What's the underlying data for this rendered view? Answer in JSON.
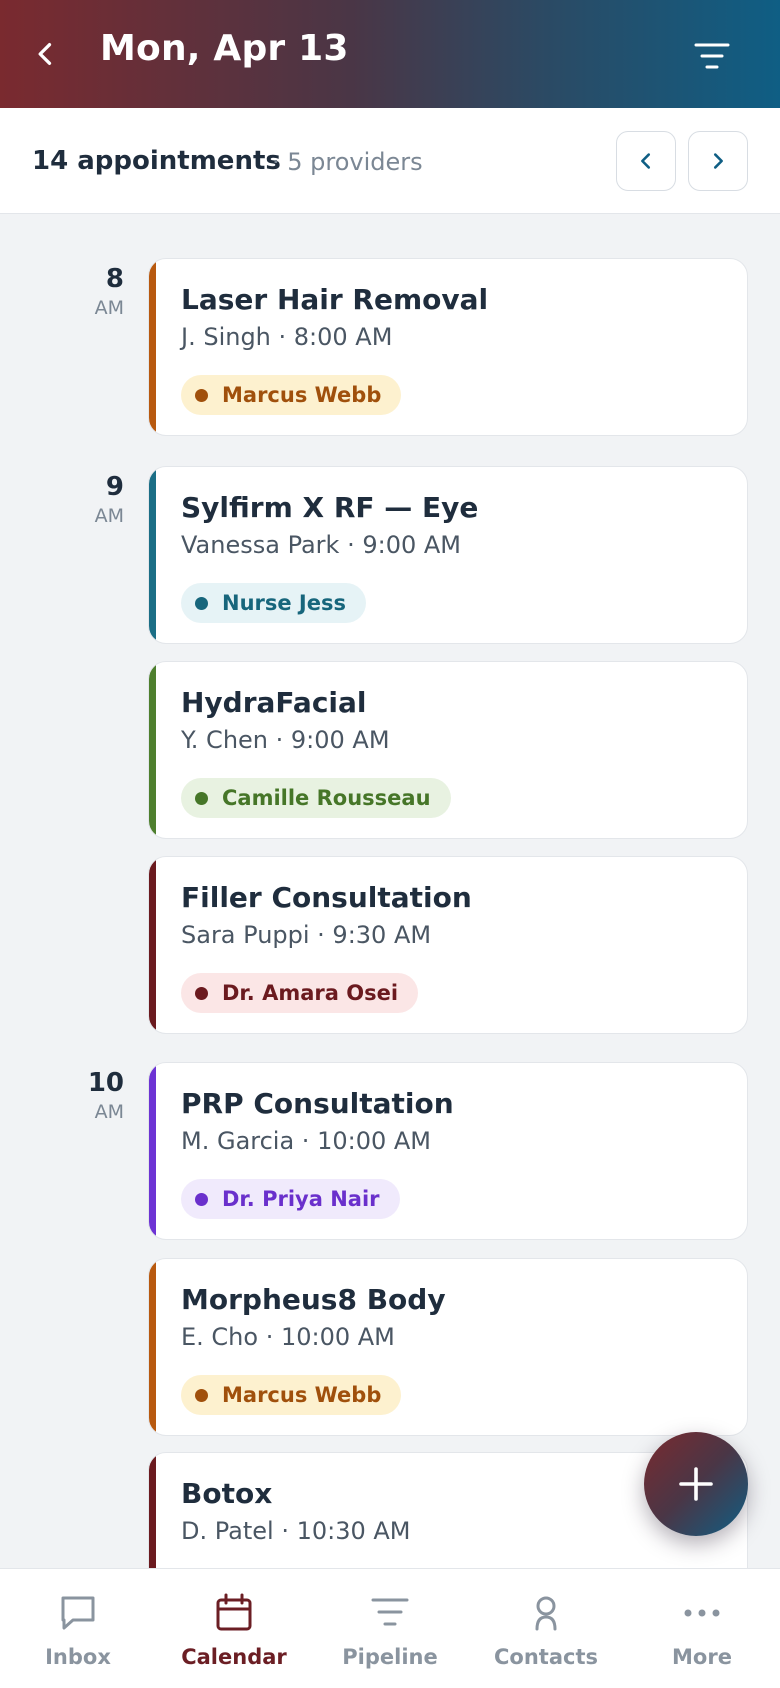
{
  "header": {
    "title": "Mon, Apr 13"
  },
  "summary": {
    "count": "14 appointments",
    "providers": "· 5 providers"
  },
  "hours": [
    {
      "hour": "8",
      "ampm": "AM"
    },
    {
      "hour": "9",
      "ampm": "AM"
    },
    {
      "hour": "10",
      "ampm": "AM"
    }
  ],
  "appointments": [
    {
      "title": "Laser Hair Removal",
      "subtitle": "J. Singh · 8:00 AM",
      "provider": "Marcus Webb",
      "accent": "#b8590f",
      "chip_bg": "#fdf1cf",
      "chip_fg": "#a0500c"
    },
    {
      "title": "Sylfirm X RF — Eye",
      "subtitle": "Vanessa Park · 9:00 AM",
      "provider": "Nurse Jess",
      "accent": "#1b6e86",
      "chip_bg": "#e6f3f6",
      "chip_fg": "#17667c"
    },
    {
      "title": "HydraFacial",
      "subtitle": "Y. Chen · 9:00 AM",
      "provider": "Camille Rousseau",
      "accent": "#4e7f2e",
      "chip_bg": "#e8f2e1",
      "chip_fg": "#467628"
    },
    {
      "title": "Filler Consultation",
      "subtitle": "Sara Puppi · 9:30 AM",
      "provider": "Dr. Amara Osei",
      "accent": "#6b1a1f",
      "chip_bg": "#fbe6e6",
      "chip_fg": "#6b1a1f"
    },
    {
      "title": "PRP Consultation",
      "subtitle": "M. Garcia · 10:00 AM",
      "provider": "Dr. Priya Nair",
      "accent": "#6d33d4",
      "chip_bg": "#f0eafc",
      "chip_fg": "#6a30cc"
    },
    {
      "title": "Morpheus8 Body",
      "subtitle": "E. Cho · 10:00 AM",
      "provider": "Marcus Webb",
      "accent": "#b8590f",
      "chip_bg": "#fdf1cf",
      "chip_fg": "#a0500c"
    },
    {
      "title": "Botox",
      "subtitle": "D. Patel · 10:30 AM",
      "provider": "",
      "accent": "#6b1a1f",
      "chip_bg": "#fbe6e6",
      "chip_fg": "#6b1a1f"
    }
  ],
  "bottom_nav": [
    {
      "label": "Inbox",
      "icon": "chat-icon",
      "active": false
    },
    {
      "label": "Calendar",
      "icon": "calendar-icon",
      "active": true
    },
    {
      "label": "Pipeline",
      "icon": "pipeline-icon",
      "active": false
    },
    {
      "label": "Contacts",
      "icon": "contact-icon",
      "active": false
    },
    {
      "label": "More",
      "icon": "more-icon",
      "active": false
    }
  ],
  "colors": {
    "brand": "#6b1e24",
    "accent_blue": "#0f5e84",
    "muted": "#8a949f"
  }
}
